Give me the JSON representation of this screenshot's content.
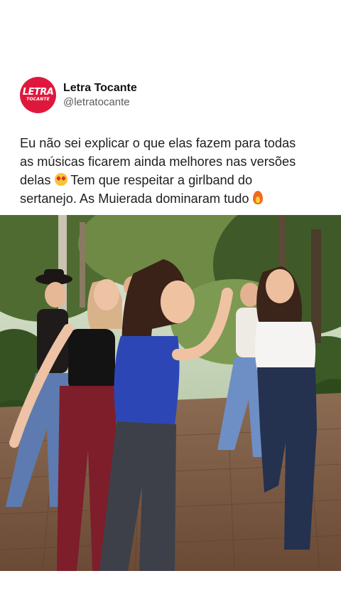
{
  "post": {
    "author": {
      "display_name": "Letra Tocante",
      "handle": "@letratocante",
      "avatar_logo_text": "LETRA",
      "avatar_logo_subtext": "TOCANTE",
      "avatar_color": "#e0173d"
    },
    "caption": {
      "line1": "Eu não sei explicar o que elas fazem para todas",
      "line2": "as músicas ficarem ainda melhores nas versões",
      "line3_before_emoji": "delas",
      "line3_after_emoji": "Tem que respeitar a girlband do",
      "line4": "sertanejo. As Muierada dominaram tudo",
      "emoji_1": "smiling-face-with-heart-eyes",
      "emoji_2": "fire"
    },
    "media": {
      "type": "photo"
    }
  }
}
